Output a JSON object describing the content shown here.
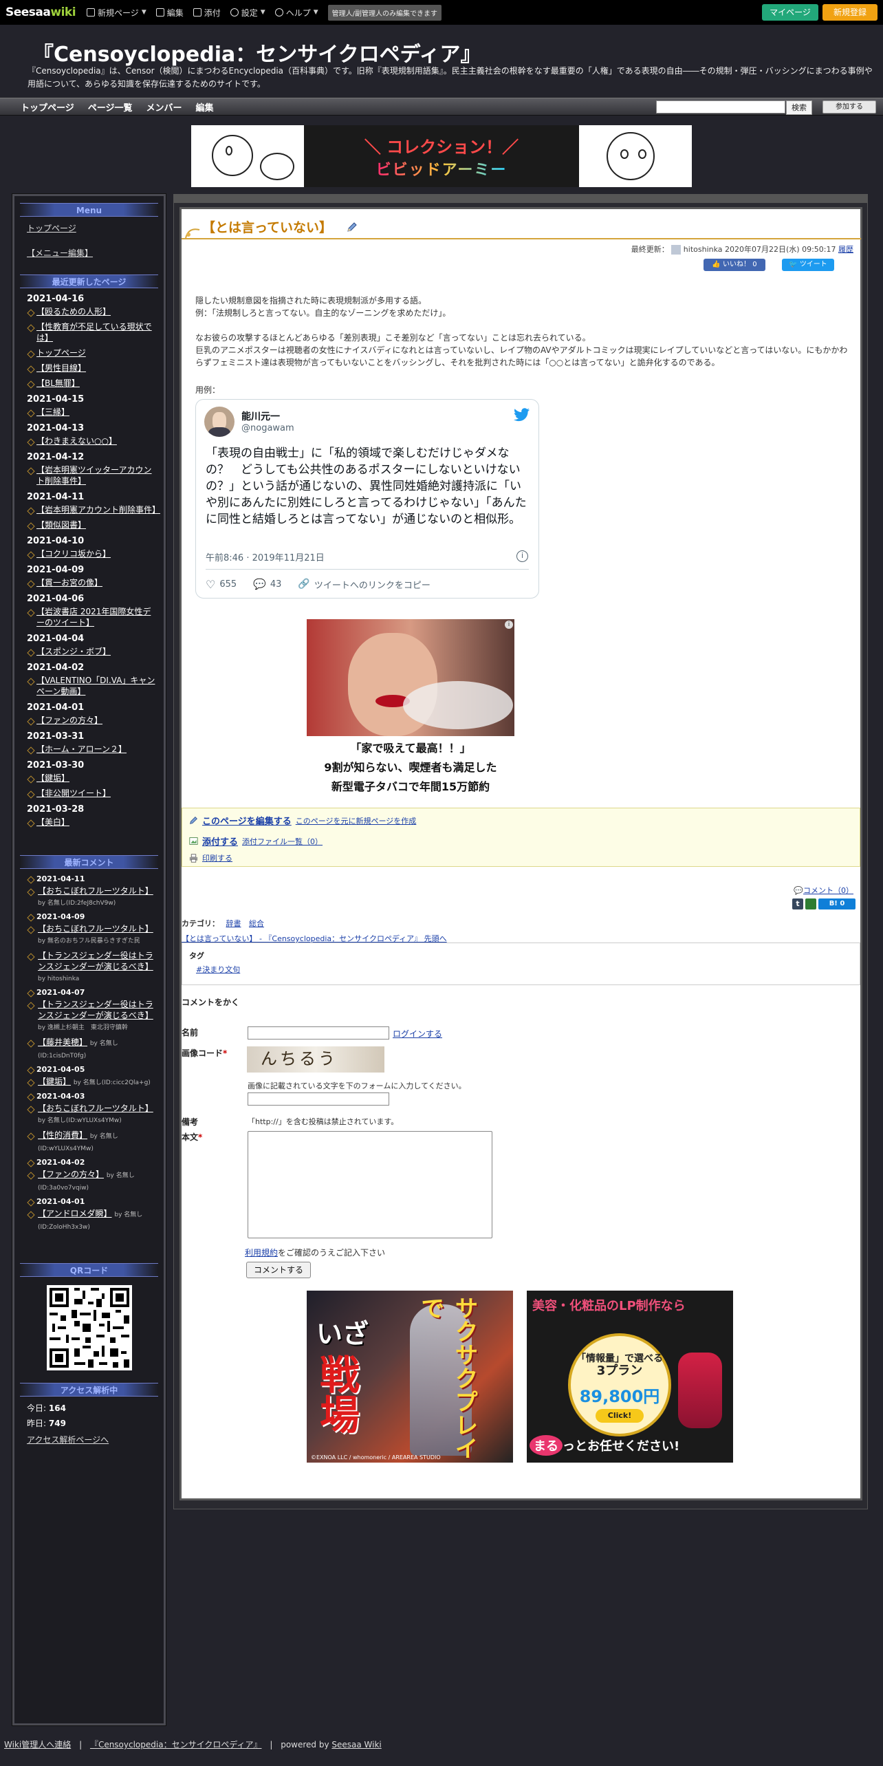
{
  "topbar": {
    "logo_main": "Seesaa",
    "logo_sub": "wiki",
    "items": [
      {
        "label": "新規ページ",
        "icon": "new-page-icon",
        "caret": true
      },
      {
        "label": "編集",
        "icon": "edit-icon",
        "caret": false
      },
      {
        "label": "添付",
        "icon": "image-icon",
        "caret": false
      },
      {
        "label": "設定",
        "icon": "gear-icon",
        "caret": true
      },
      {
        "label": "ヘルプ",
        "icon": "help-icon",
        "caret": true
      }
    ],
    "admin_label": "管理人/副管理人のみ編集できます",
    "mypage_label": "マイページ",
    "register_label": "新規登録",
    "colors": {
      "mypage": "#22a87a",
      "register": "#f1a212"
    }
  },
  "header": {
    "title": "『Censoyclopedia：センサイクロペディア』",
    "description": "『Censoyclopedia』は、Censor（検閲）にまつわるEncyclopedia（百科事典）です。旧称『表現規制用語集』。民主主義社会の根幹をなす最重要の「人権」である表現の自由――その規制・弾圧・バッシングにまつわる事例や用語について、あらゆる知識を保存伝達するためのサイトです。"
  },
  "nav": {
    "items": [
      "トップページ",
      "ページ一覧",
      "メンバー",
      "編集"
    ],
    "search_button": "検索",
    "join_button": "参加する"
  },
  "banner": {
    "top_text": "＼ コレクション！／",
    "logo_text": "ビビッドアーミー"
  },
  "sidebar": {
    "menu_title": "Menu",
    "menu_links": [
      "トップページ",
      "【メニュー編集】"
    ],
    "recent_title": "最近更新したページ",
    "recent": [
      {
        "date": "2021-04-16",
        "pages": [
          "【殴るための人形】",
          "【性教育が不足している現状では】",
          "トップページ",
          "【男性目線】",
          "【BL無罪】"
        ]
      },
      {
        "date": "2021-04-15",
        "pages": [
          "【三縁】"
        ]
      },
      {
        "date": "2021-04-13",
        "pages": [
          "【わきまえない○○】"
        ]
      },
      {
        "date": "2021-04-12",
        "pages": [
          "【岩本明憲ツイッターアカウント削除事件】"
        ]
      },
      {
        "date": "2021-04-11",
        "pages": [
          "【岩本明憲アカウント削除事件】",
          "【類似図書】"
        ]
      },
      {
        "date": "2021-04-10",
        "pages": [
          "【コクリコ坂から】"
        ]
      },
      {
        "date": "2021-04-09",
        "pages": [
          "【貫一お宮の像】"
        ]
      },
      {
        "date": "2021-04-06",
        "pages": [
          "【岩波書店 2021年国際女性デーのツイート】"
        ]
      },
      {
        "date": "2021-04-04",
        "pages": [
          "【スポンジ・ボブ】"
        ]
      },
      {
        "date": "2021-04-02",
        "pages": [
          "【VALENTINO「DI.VA」キャンペーン動画】"
        ]
      },
      {
        "date": "2021-04-01",
        "pages": [
          "【ファンの方々】"
        ]
      },
      {
        "date": "2021-03-31",
        "pages": [
          "【ホーム・アローン２】"
        ]
      },
      {
        "date": "2021-03-30",
        "pages": [
          "【鍵垢】",
          "【非公開ツイート】"
        ]
      },
      {
        "date": "2021-03-28",
        "pages": [
          "【美白】"
        ]
      }
    ],
    "comments_title": "最新コメント",
    "comments": [
      {
        "date": "2021-04-11",
        "items": [
          {
            "page": "【おちこぼれフルーツタルト】",
            "by": "by 名無し(ID:2feJ8chV9w)"
          }
        ]
      },
      {
        "date": "2021-04-09",
        "items": [
          {
            "page": "【おちこぼれフルーツタルト】",
            "by": "by 無名のおちフル民暴らきすぎた民"
          },
          {
            "page": "【トランスジェンダー役はトランスジェンダーが演じるべき】",
            "by": "by hitoshinka"
          }
        ]
      },
      {
        "date": "2021-04-07",
        "items": [
          {
            "page": "【トランスジェンダー役はトランスジェンダーが演じるべき】",
            "by": "by 逸槻上杉朝主　東北羽守鎮幹"
          },
          {
            "page": "【藤井美穂】",
            "by": "by 名無し(ID:1cisDnT0fg)"
          }
        ]
      },
      {
        "date": "2021-04-05",
        "items": [
          {
            "page": "【鍵垢】",
            "by": "by 名無し(ID:cicc2Qla+g)"
          }
        ]
      },
      {
        "date": "2021-04-03",
        "items": [
          {
            "page": "【おちこぼれフルーツタルト】",
            "by": "by 名無し(ID:wYLUXs4YMw)"
          },
          {
            "page": "【性的消費】",
            "by": "by 名無し(ID:wYLUXs4YMw)"
          }
        ]
      },
      {
        "date": "2021-04-02",
        "items": [
          {
            "page": "【ファンの方々】",
            "by": "by 名無し(ID:3a0vo7vqiw)"
          }
        ]
      },
      {
        "date": "2021-04-01",
        "items": [
          {
            "page": "【アンドロメダ瞬】",
            "by": "by 名無し(ID:ZoloHh3x3w)"
          }
        ]
      }
    ],
    "qr_title": "QRコード",
    "access_title": "アクセス解析中",
    "today_label": "今日:",
    "today_value": "164",
    "yesterday_label": "昨日:",
    "yesterday_value": "749",
    "access_link": "アクセス解析ページへ"
  },
  "main": {
    "page_title": "【とは言っていない】",
    "updated_prefix": "最終更新：",
    "updated_user": "hitoshinka",
    "updated_at": "2020年07月22日(水) 09:50:17",
    "history_link": "履歴",
    "like_label": "いいね！ 0",
    "tweet_label": "ツイート",
    "paragraph1": "隠したい規制意図を指摘された時に表現規制派が多用する語。",
    "paragraph2": "例：「法規制しろと言ってない。自主的なゾーニングを求めただけ」。",
    "paragraph3": "なお彼らの攻撃するほとんどあらゆる「差別表現」こそ差別など「言ってない」ことは忘れ去られている。",
    "paragraph4": "巨乳のアニメポスターは視聴者の女性にナイスバディになれとは言っていないし、レイプ物のAVやアダルトコミックは現実にレイプしていいなどと言ってはいない。にもかかわらずフェミニスト達は表現物が言ってもいないことをバッシングし、それを批判された時には「○○とは言ってない」と詭弁化するのである。",
    "example_label": "用例：",
    "tweet": {
      "name": "能川元一",
      "handle": "@nogawam",
      "text": "「表現の自由戦士」に「私的領域で楽しむだけじゃダメなの？　どうしても公共性のあるポスターにしないといけないの？」という話が通じないの、異性同姓婚絶対護持派に「いや別にあんたに別姓にしろと言ってるわけじゃない」「あんたに同性と結婚しろとは言ってない」が通じないのと相似形。",
      "time": "午前8:46 · 2019年11月21日",
      "likes": "655",
      "replies": "43",
      "copy_link": "ツイートへのリンクをコピー"
    },
    "ad1_caption": [
      "「家で吸えて最高！！」",
      "9割が知らない、喫煙者も満足した",
      "新型電子タバコで年間15万節約"
    ],
    "edit_box": {
      "edit_link": "このページを編集する",
      "new_page_link": "このページを元に新規ページを作成",
      "attach_link": "添付する",
      "attach_list": "添付ファイル一覧（0）",
      "print_link": "印刷する"
    },
    "comment_count_link": "コメント（0）",
    "hatena_label": "B! 0",
    "category_label": "カテゴリ：",
    "categories": [
      "辞書",
      "総合"
    ],
    "breadcrumb": "【とは言っていない】 - 『Censoyclopedia：センサイクロペディア』 先頭へ",
    "tag_label": "タグ",
    "tag": "#決まり文句",
    "form": {
      "title": "コメントをかく",
      "name_label": "名前",
      "login_link": "ログインする",
      "captcha_label": "画像コード",
      "captcha_text": "んちるう",
      "captcha_help": "画像に記載されている文字を下のフォームに入力してください。",
      "note_label": "備考",
      "note_text": "「http://」を含む投稿は禁止されています。",
      "body_label": "本文",
      "terms_link": "利用規約",
      "terms_suffix": "をご確認のうえご記入下さい",
      "submit_label": "コメントする"
    },
    "ad2": {
      "text1": "サクサクプレイで",
      "text2": "いざ",
      "text3": "戦場",
      "footer": "©EXNOA LLC / whomoneric / AREAREA STUDIO"
    },
    "ad3": {
      "title": "美容・化粧品のLP制作なら",
      "line1": "「情報量」で選べる",
      "line2": "3プラン",
      "price": "89,800円~",
      "cta": "Click!",
      "bottom1": "まる",
      "bottom2": "っとお任せください!"
    }
  },
  "footer": {
    "contact": "Wiki管理人へ連絡",
    "site_link": "『Censoyclopedia：センサイクロペディア』",
    "powered_prefix": "powered by",
    "powered_link": "Seesaa Wiki"
  }
}
